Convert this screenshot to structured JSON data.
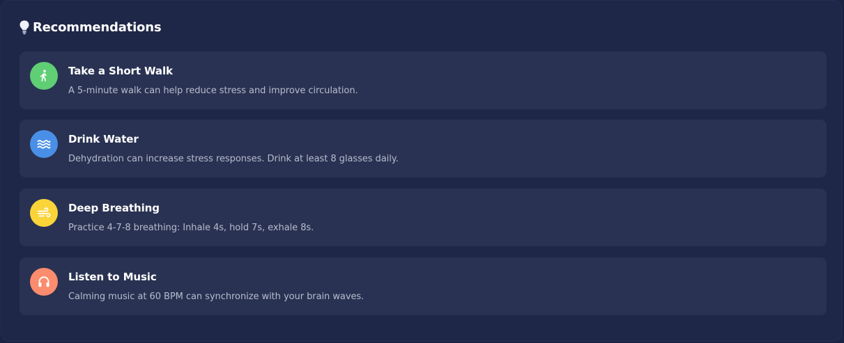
{
  "header": {
    "icon": "lightbulb-icon",
    "title": "Recommendations"
  },
  "recommendations": [
    {
      "title": "Take a Short Walk",
      "description": "A 5-minute walk can help reduce stress and improve circulation.",
      "icon": "walking-person-icon",
      "color": "#5fce75"
    },
    {
      "title": "Drink Water",
      "description": "Dehydration can increase stress responses. Drink at least 8 glasses daily.",
      "icon": "water-waves-icon",
      "color": "#4a8fe7"
    },
    {
      "title": "Deep Breathing",
      "description": "Practice 4-7-8 breathing: Inhale 4s, hold 7s, exhale 8s.",
      "icon": "wind-icon",
      "color": "#fbd43a"
    },
    {
      "title": "Listen to Music",
      "description": "Calming music at 60 BPM can synchronize with your brain waves.",
      "icon": "headphones-icon",
      "color": "#fb8c6e"
    }
  ],
  "colors": {
    "background": "#1b2342",
    "panel": "#1e2747",
    "card": "#293252",
    "title_text": "#ffffff",
    "description_text": "#b7bccd"
  }
}
